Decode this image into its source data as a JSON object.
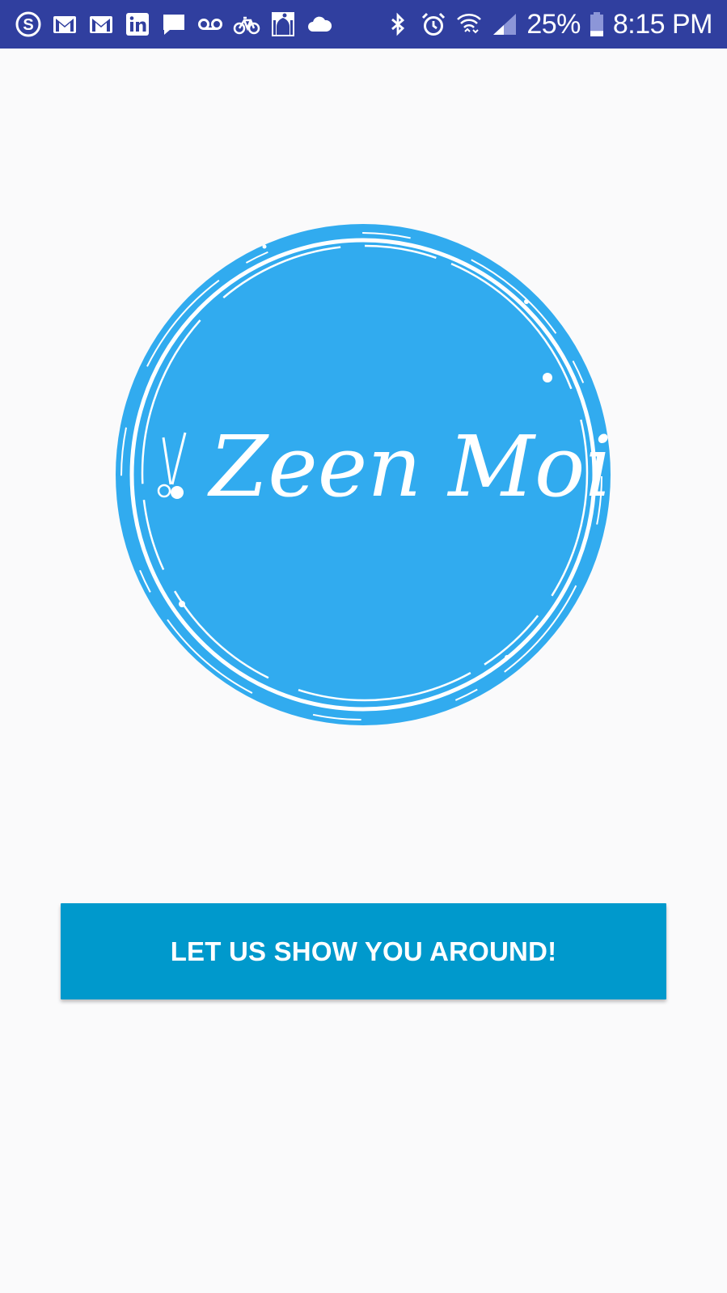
{
  "status_bar": {
    "battery_percent": "25%",
    "battery_level": 25,
    "time": "8:15 PM",
    "icons_left": [
      "skype-icon",
      "gmail-icon",
      "gmail-icon",
      "linkedin-icon",
      "message-icon",
      "voicemail-icon",
      "bicycle-icon",
      "prayer-app-icon",
      "cloud-icon"
    ],
    "icons_right": [
      "bluetooth-icon",
      "alarm-icon",
      "wifi-icon",
      "cellular-signal-icon",
      "battery-icon"
    ],
    "background_color": "#303f9f"
  },
  "logo": {
    "brand_name": "Zeen Moi",
    "icon": "scissors-icon",
    "circle_color": "#31abef"
  },
  "cta": {
    "label": "LET US SHOW YOU AROUND!",
    "color": "#0099cc"
  }
}
